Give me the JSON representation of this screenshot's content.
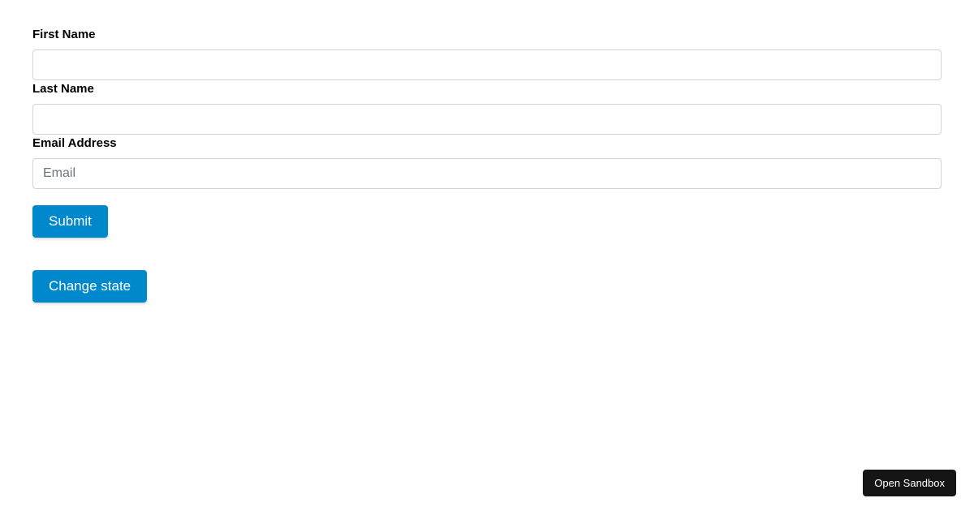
{
  "form": {
    "fields": {
      "firstName": {
        "label": "First Name",
        "value": "",
        "placeholder": ""
      },
      "lastName": {
        "label": "Last Name",
        "value": "",
        "placeholder": ""
      },
      "email": {
        "label": "Email Address",
        "value": "",
        "placeholder": "Email"
      }
    },
    "submitLabel": "Submit",
    "changeStateLabel": "Change state"
  },
  "sandbox": {
    "openLabel": "Open Sandbox"
  }
}
